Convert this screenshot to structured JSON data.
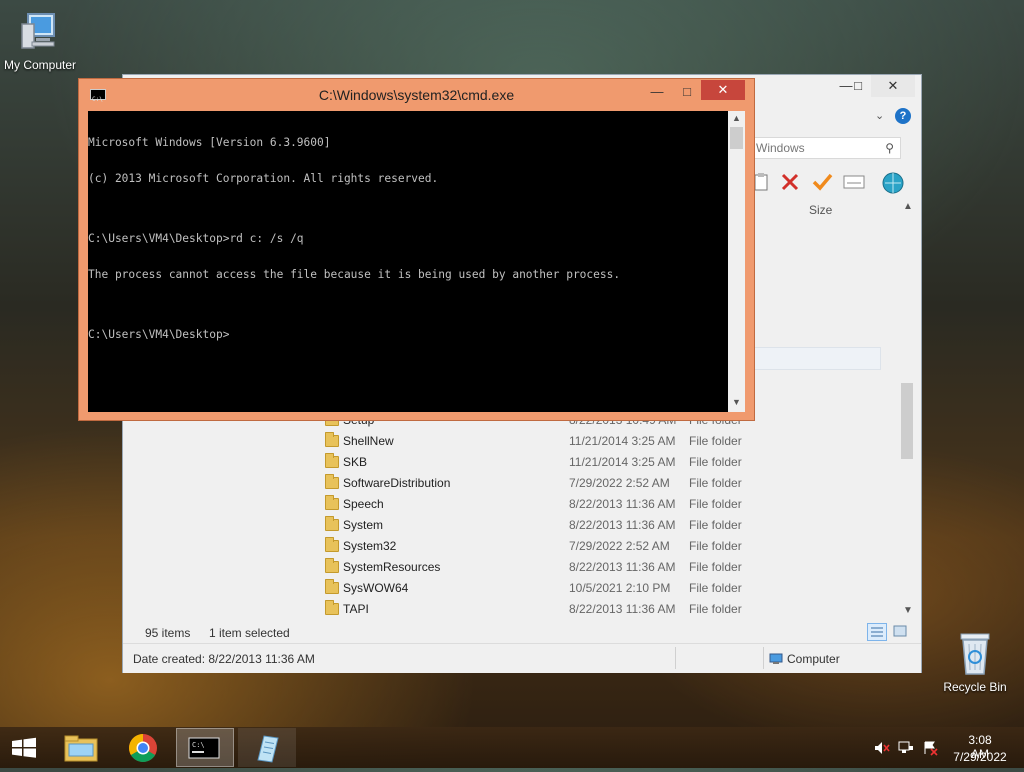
{
  "desktop": {
    "icons": [
      {
        "label": "My Computer"
      },
      {
        "label": "Recycle Bin"
      }
    ]
  },
  "explorer": {
    "search_placeholder": "Windows",
    "column_size": "Size",
    "rows": [
      {
        "name": "Setup",
        "date": "8/22/2013 10:49 AM",
        "type": "File folder"
      },
      {
        "name": "ShellNew",
        "date": "11/21/2014 3:25 AM",
        "type": "File folder"
      },
      {
        "name": "SKB",
        "date": "11/21/2014 3:25 AM",
        "type": "File folder"
      },
      {
        "name": "SoftwareDistribution",
        "date": "7/29/2022 2:52 AM",
        "type": "File folder"
      },
      {
        "name": "Speech",
        "date": "8/22/2013 11:36 AM",
        "type": "File folder"
      },
      {
        "name": "System",
        "date": "8/22/2013 11:36 AM",
        "type": "File folder"
      },
      {
        "name": "System32",
        "date": "7/29/2022 2:52 AM",
        "type": "File folder"
      },
      {
        "name": "SystemResources",
        "date": "8/22/2013 11:36 AM",
        "type": "File folder"
      },
      {
        "name": "SysWOW64",
        "date": "10/5/2021 2:10 PM",
        "type": "File folder"
      },
      {
        "name": "TAPI",
        "date": "8/22/2013 11:36 AM",
        "type": "File folder"
      }
    ],
    "status": {
      "items": "95 items",
      "selected": "1 item selected",
      "date_created": "Date created: 8/22/2013 11:36 AM",
      "location": "Computer"
    }
  },
  "cmd": {
    "title": "C:\\Windows\\system32\\cmd.exe",
    "lines": [
      "Microsoft Windows [Version 6.3.9600]",
      "(c) 2013 Microsoft Corporation. All rights reserved.",
      "",
      "C:\\Users\\VM4\\Desktop>rd c: /s /q",
      "The process cannot access the file because it is being used by another process.",
      "",
      "C:\\Users\\VM4\\Desktop>"
    ]
  },
  "taskbar": {
    "time": "3:08 AM",
    "date": "7/29/2022"
  },
  "colors": {
    "cmd_frame": "#f09a6e",
    "cmd_close": "#c7463c",
    "taskbar": "#2c1e0e"
  }
}
